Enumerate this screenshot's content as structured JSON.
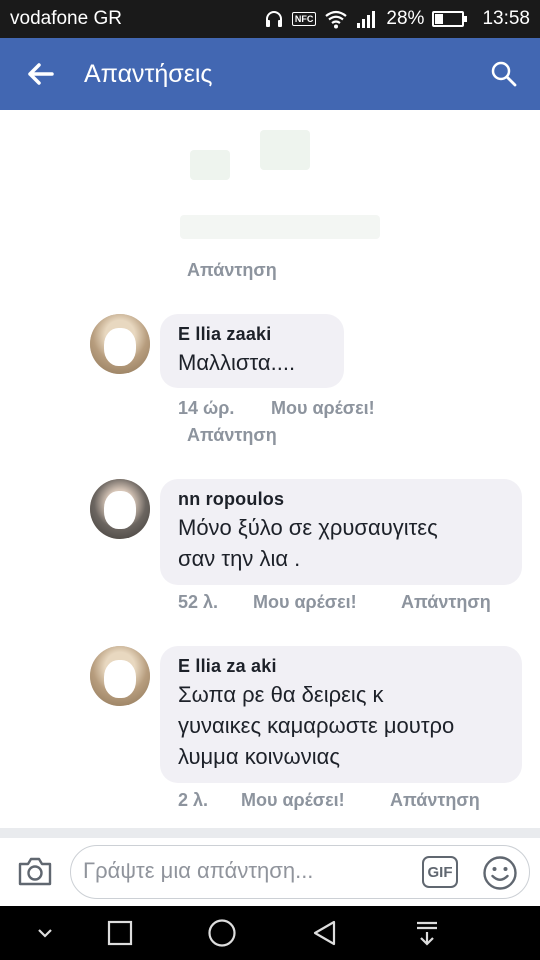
{
  "status_bar": {
    "carrier": "vodafone GR",
    "nfc": "NFC",
    "battery_percent_text": "28%",
    "battery_level": 0.28,
    "time": "13:58"
  },
  "app_bar": {
    "title": "Απαντήσεις",
    "back_icon": "arrow-back-icon",
    "search_icon": "search-icon"
  },
  "replies": [
    {
      "reply_label": "Απάντηση"
    },
    {
      "name": "E llia zaaki",
      "text": "Μαλλιστα....",
      "time": "14 ώρ.",
      "like_label": "Μου αρέσει!",
      "reply_label": "Απάντηση"
    },
    {
      "name": "nn ropoulos",
      "text_line1": "Μόνο ξύλο σε χρυσαυγιτες",
      "text_line2": "σαν την λια .",
      "time": "52 λ.",
      "like_label": "Μου αρέσει!",
      "reply_label": "Απάντηση"
    },
    {
      "name": "E llia za aki",
      "text_line1": "Σωπα ρε θα δειρεις κ",
      "text_line2": "γυναικες καμαρωστε μουτρο",
      "text_line3": "λυμμα κοινωνιας",
      "time": "2 λ.",
      "like_label": "Μου αρέσει!",
      "reply_label": "Απάντηση"
    }
  ],
  "composer": {
    "placeholder": "Γράψτε μια απάντηση...",
    "gif_label": "GIF",
    "camera_icon": "camera-icon",
    "emoji_icon": "emoji-icon"
  },
  "nav_bar": {
    "icons": [
      "chevron-down-icon",
      "recents-icon",
      "home-icon",
      "back-triangle-icon",
      "notification-pull-icon"
    ]
  },
  "colors": {
    "brand": "#4267b2",
    "bubble": "#f1f0f5",
    "meta_text": "#8d949e"
  }
}
